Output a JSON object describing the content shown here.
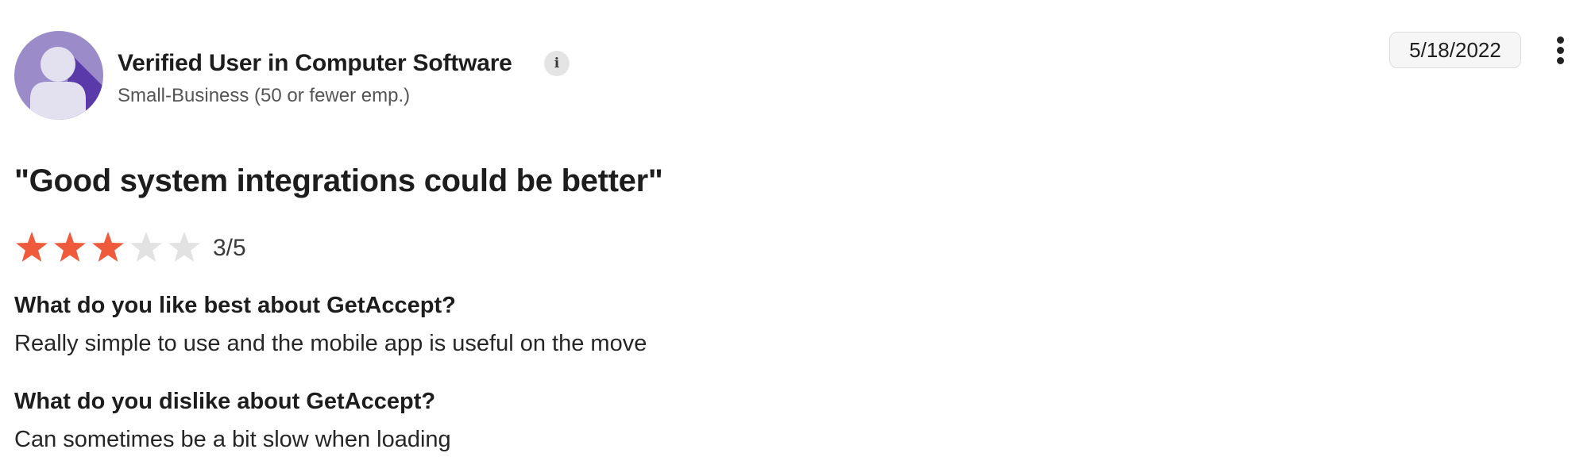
{
  "reviewer": {
    "name": "Verified User in Computer Software",
    "info_icon": "info-icon",
    "info_glyph": "i",
    "company_size": "Small-Business (50 or fewer emp.)",
    "avatar_icon": "person-silhouette-icon"
  },
  "date": "5/18/2022",
  "menu_icon": "more-vertical-icon",
  "review": {
    "title": "\"Good system integrations could be better\"",
    "rating": {
      "value": 3,
      "max": 5,
      "label": "3/5",
      "filled_color": "#ef5a3c",
      "empty_color": "#e2e2e2"
    },
    "sections": [
      {
        "question": "What do you like best about GetAccept?",
        "answer": "Really simple to use and the mobile app is useful on the move"
      },
      {
        "question": "What do you dislike about GetAccept?",
        "answer": "Can sometimes be a bit slow when loading"
      }
    ]
  },
  "colors": {
    "avatar_background": "#9b8cc9",
    "avatar_shadow": "#5a3aa8",
    "avatar_figure": "#e3e0f0"
  }
}
